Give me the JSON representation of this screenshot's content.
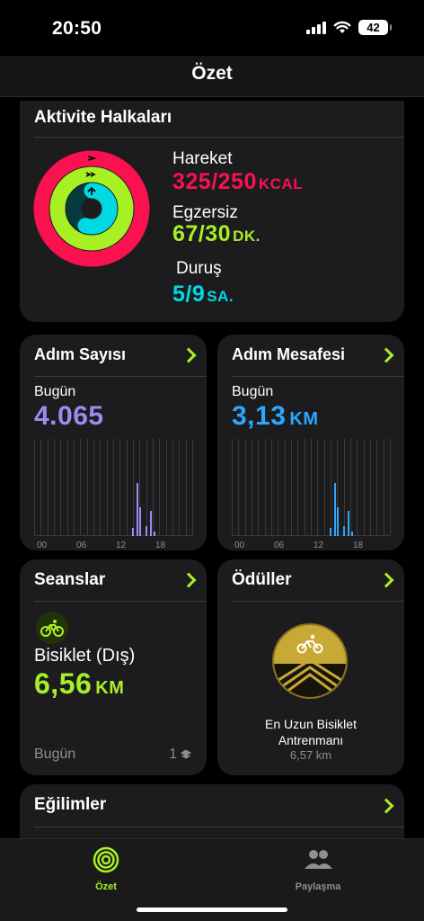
{
  "status": {
    "time": "20:50",
    "battery": "42"
  },
  "header": {
    "title": "Özet"
  },
  "activity": {
    "title": "Aktivite Halkaları",
    "move": {
      "label": "Hareket",
      "value": "325/250",
      "unit": "KCAL",
      "progress": 1.3
    },
    "exercise": {
      "label": "Egzersiz",
      "value": "67/30",
      "unit": "DK.",
      "progress": 2.23
    },
    "stand": {
      "label": "Duruş",
      "value": "5/9",
      "unit": "SA.",
      "progress": 0.556
    }
  },
  "steps": {
    "title": "Adım Sayısı",
    "period": "Bugün",
    "value": "4.065",
    "ticks": [
      "00",
      "06",
      "12",
      "18"
    ]
  },
  "distance": {
    "title": "Adım Mesafesi",
    "period": "Bugün",
    "value": "3,13",
    "unit": "KM",
    "ticks": [
      "00",
      "06",
      "12",
      "18"
    ]
  },
  "sessions": {
    "title": "Seanslar",
    "activity": "Bisiklet (Dış)",
    "value": "6,56",
    "unit": "KM",
    "period": "Bugün",
    "count": "1"
  },
  "awards": {
    "title": "Ödüller",
    "name": "En Uzun Bisiklet Antrenmanı",
    "value": "6,57 km"
  },
  "trends": {
    "title": "Eğilimler"
  },
  "tabs": [
    {
      "label": "Özet"
    },
    {
      "label": "Paylaşma"
    }
  ],
  "colors": {
    "move": "#fa114f",
    "exercise": "#a8f024",
    "stand": "#00d9e4",
    "steps": "#9a8cf0",
    "distance": "#2aa8ff",
    "accent": "#a8f024"
  }
}
